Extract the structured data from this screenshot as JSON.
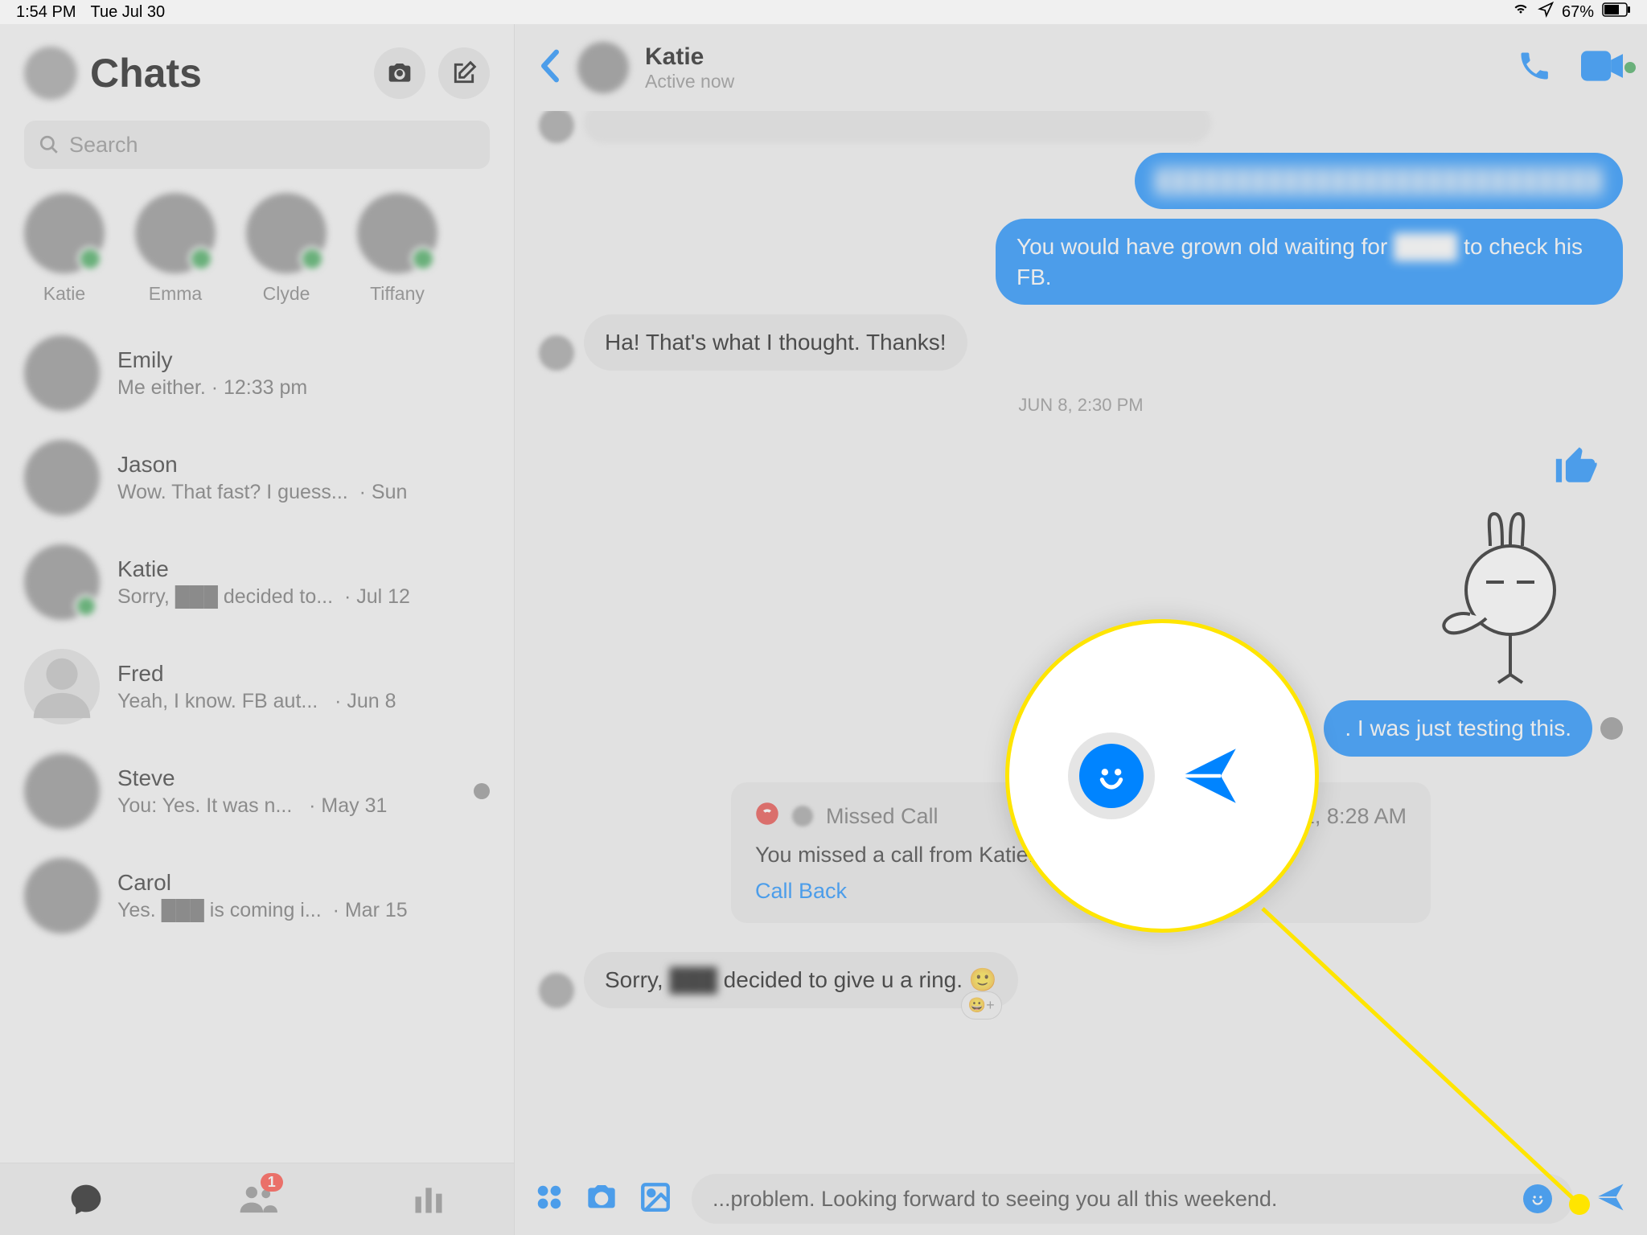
{
  "status": {
    "time": "1:54 PM",
    "date": "Tue Jul 30",
    "battery": "67%"
  },
  "sidebar": {
    "title": "Chats",
    "search_placeholder": "Search",
    "stories": [
      {
        "name": "Katie"
      },
      {
        "name": "Emma"
      },
      {
        "name": "Clyde"
      },
      {
        "name": "Tiffany"
      }
    ],
    "chats": [
      {
        "name": "Emily",
        "preview": "Me either.",
        "time": "12:33 pm"
      },
      {
        "name": "Jason",
        "preview": "Wow. That fast? I guess...",
        "time": "Sun"
      },
      {
        "name": "Katie",
        "preview": "Sorry, ███ decided to...",
        "time": "Jul 12",
        "online": true
      },
      {
        "name": "Fred",
        "preview": "Yeah, I know. FB aut...",
        "time": "Jun 8",
        "placeholder": true
      },
      {
        "name": "Steve",
        "preview": "You: Yes. It was n...",
        "time": "May 31",
        "badge": true
      },
      {
        "name": "Carol",
        "preview": "Yes. ███ is coming i...",
        "time": "Mar 15"
      }
    ],
    "tabs": {
      "people_badge": "1"
    }
  },
  "conversation": {
    "name": "Katie",
    "status": "Active now",
    "messages": {
      "out1_hidden": "████████████████████████████",
      "out2_pre": "You would have grown old waiting for ",
      "out2_blur": "████",
      "out2_post": " to check his FB.",
      "in1": "Ha! That's what I thought. Thanks!",
      "ts1": "JUN 8, 2:30 PM",
      "out3": ". I was just testing this.",
      "in2_pre": "Sorry, ",
      "in2_blur": "███",
      "in2_post": " decided to give u a ring. 🙂"
    },
    "call": {
      "title": "Missed Call",
      "time": "l 12, 8:28 AM",
      "text": "You missed a call from Katie.",
      "action": "Call Back"
    },
    "composer": {
      "text": "...problem. Looking forward to seeing you all this weekend."
    }
  }
}
